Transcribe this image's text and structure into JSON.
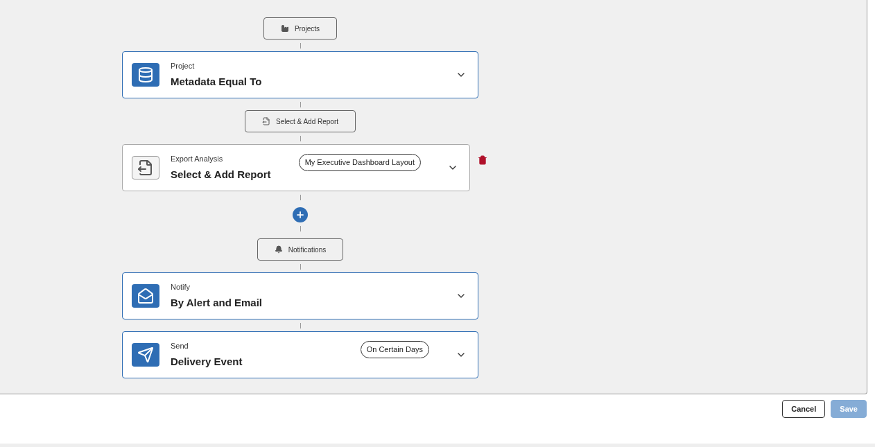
{
  "flow": [
    {
      "kind": "section",
      "label": "Projects"
    },
    {
      "kind": "card",
      "active": true,
      "deletable": false,
      "caption": "Project",
      "title": "Metadata Equal To"
    },
    {
      "kind": "section",
      "label": "Select & Add Report"
    },
    {
      "kind": "card",
      "active": false,
      "deletable": true,
      "caption": "Export Analysis",
      "title": "Select & Add Report",
      "tag": "My Executive Dashboard Layout"
    },
    {
      "kind": "add"
    },
    {
      "kind": "section",
      "label": "Notifications"
    },
    {
      "kind": "card",
      "active": true,
      "deletable": false,
      "caption": "Notify",
      "title": "By Alert and Email"
    },
    {
      "kind": "card",
      "active": true,
      "deletable": false,
      "caption": "Send",
      "title": "Delivery Event",
      "tag": "On Certain Days"
    }
  ],
  "footer": {
    "buttons": [
      {
        "kind": "cancel",
        "label": "Cancel",
        "disabled": false
      },
      {
        "kind": "save",
        "label": "Save",
        "disabled": true
      }
    ]
  }
}
